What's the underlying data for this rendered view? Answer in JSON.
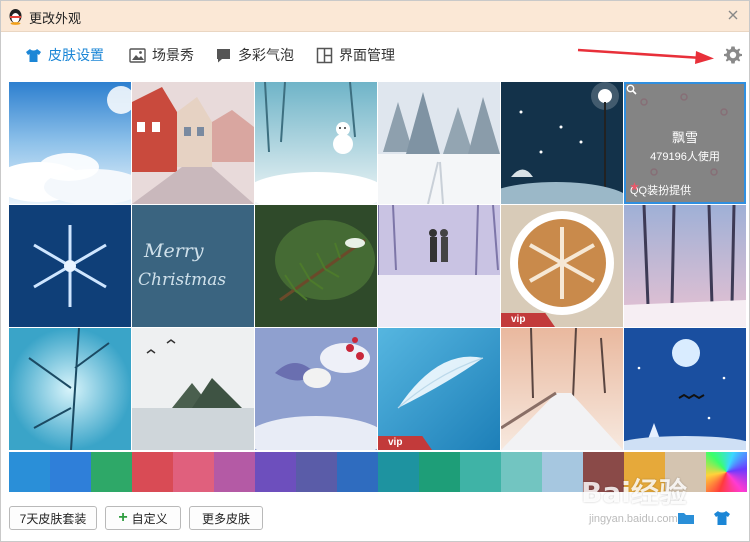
{
  "window": {
    "title": "更改外观",
    "close_icon": "close-icon",
    "title_bar_color": "#fbe8d6"
  },
  "tabs": [
    {
      "label": "皮肤设置",
      "icon": "tshirt-icon",
      "active": true
    },
    {
      "label": "场景秀",
      "icon": "picture-icon",
      "active": false
    },
    {
      "label": "多彩气泡",
      "icon": "chat-bubble-icon",
      "active": false
    },
    {
      "label": "界面管理",
      "icon": "layout-icon",
      "active": false
    }
  ],
  "settings_icon": "gear-icon",
  "accent_color": "#1b86d6",
  "skins": [
    {
      "theme": "sky-clouds"
    },
    {
      "theme": "winter-street"
    },
    {
      "theme": "snowman"
    },
    {
      "theme": "snowy-forest"
    },
    {
      "theme": "night-lamp"
    },
    {
      "theme": "snow-flakes",
      "hover": {
        "name": "飘雪",
        "users": "479196人使用",
        "provider": "QQ装扮提供"
      }
    },
    {
      "theme": "snowflake-blue"
    },
    {
      "theme": "merry-christmas",
      "text": "Merry Christmas"
    },
    {
      "theme": "pine-branch"
    },
    {
      "theme": "couple-snow"
    },
    {
      "theme": "latte-snowflake",
      "badge": "vip"
    },
    {
      "theme": "winter-trees-pink"
    },
    {
      "theme": "blue-branches"
    },
    {
      "theme": "frozen-lake"
    },
    {
      "theme": "bird-berries"
    },
    {
      "theme": "feather",
      "badge": "vip"
    },
    {
      "theme": "snowy-bridge"
    },
    {
      "theme": "christmas-night"
    }
  ],
  "colors": [
    "#2a8fd8",
    "#2f7fd9",
    "#2ea868",
    "#d94b55",
    "#e0607d",
    "#b45aa5",
    "#6d4fbd",
    "#5a5ca8",
    "#2f6cbf",
    "#1e93a0",
    "#1e9e78",
    "#3fb3a6",
    "#72c5c1",
    "#a6c7e0",
    "#8a4a48",
    "#e6a93a",
    "#d4c4b0",
    "rainbow"
  ],
  "footer": {
    "package_label": "7天皮肤套装",
    "custom_label": "自定义",
    "more_label": "更多皮肤",
    "folder_icon": "folder-icon",
    "tshirt_icon": "tshirt-icon"
  },
  "watermark": {
    "brand": "Bai经验",
    "url": "jingyan.baidu.com"
  }
}
